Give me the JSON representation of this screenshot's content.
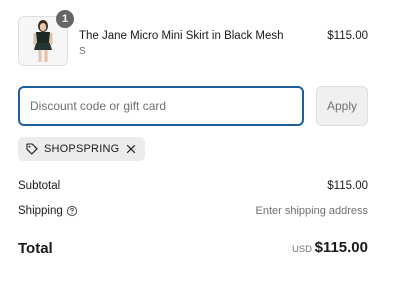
{
  "line_items": [
    {
      "name": "The Jane Micro Mini Skirt in Black Mesh",
      "variant": "S",
      "price": "$115.00",
      "quantity": "1",
      "thumbnail_icon": "product-photo-model-in-black-outfit"
    }
  ],
  "discount": {
    "placeholder": "Discount code or gift card",
    "value": "",
    "apply_label": "Apply",
    "applied_code": "SHOPSPRING"
  },
  "summary": {
    "subtotal_label": "Subtotal",
    "subtotal_value": "$115.00",
    "shipping_label": "Shipping",
    "shipping_value": "Enter shipping address"
  },
  "total": {
    "label": "Total",
    "currency": "USD",
    "amount": "$115.00"
  },
  "colors": {
    "focus_border": "#1f5f99",
    "badge": "#666666",
    "chip_bg": "#ececec",
    "muted_text": "#707070"
  }
}
